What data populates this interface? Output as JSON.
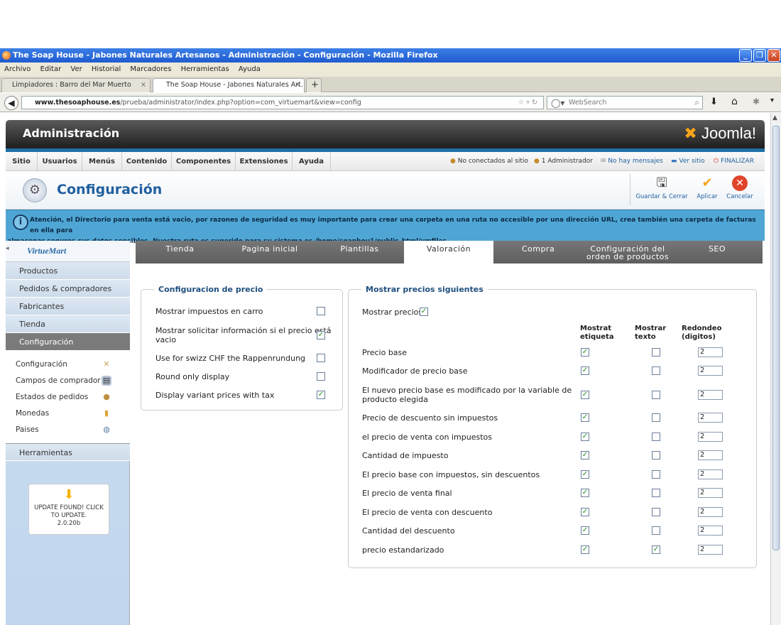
{
  "window": {
    "title": "The Soap House - Jabones Naturales Artesanos - Administración - Configuración - Mozilla Firefox"
  },
  "menubar": [
    "Archivo",
    "Editar",
    "Ver",
    "Historial",
    "Marcadores",
    "Herramientas",
    "Ayuda"
  ],
  "tabs": [
    {
      "label": "Limpiadores : Barro del Mar Muerto"
    },
    {
      "label": "The Soap House - Jabones Naturales Art..."
    }
  ],
  "url": {
    "domain": "www.thesoaphouse.es",
    "path": "/prueba/administrator/index.php?option=com_virtuemart&view=config"
  },
  "search": {
    "placeholder": "WebSearch"
  },
  "admin": {
    "title": "Administración",
    "brand": "Joomla!"
  },
  "topmenu": [
    "Sitio",
    "Usuarios",
    "Menús",
    "Contenido",
    "Componentes",
    "Extensiones",
    "Ayuda"
  ],
  "status": {
    "not_connected": "No conectados al sitio",
    "admins": "1 Administrador",
    "messages": "No hay mensajes",
    "view_site": "Ver sitio",
    "logout": "FINALIZAR"
  },
  "toolbar": {
    "title": "Configuración",
    "save_close": "Guardar & Cerrar",
    "apply": "Aplicar",
    "cancel": "Cancelar"
  },
  "warning": {
    "line1": "Atención, el Directorio para venta está vacio, por razones de seguridad es muy importante para crear una carpeta en una ruta no accesible por una dirección URL, crea también una carpeta de facturas en ella para",
    "line2": "almacenar seguros sus datos sensibles. Nuestra ruta es sugerido para su sistema es /home/soaphou1/public_html/vmfiles"
  },
  "sidebar": {
    "logo": "VirtueMart",
    "items": [
      "Productos",
      "Pedidos & compradores",
      "Fabricantes",
      "Tienda",
      "Configuración"
    ],
    "subitems": [
      "Configuración",
      "Campos de comprador",
      "Estados de pedidos",
      "Monedas",
      "Paises"
    ],
    "tools": "Herramientas",
    "update": "UPDATE FOUND! CLICK TO UPDATE.",
    "version": "2.0.20b"
  },
  "maintabs": [
    "Tienda",
    "Pagina inicial",
    "Plantillas",
    "Valoración",
    "Compra",
    "Configuración del",
    "orden de productos",
    "SEO"
  ],
  "price_config": {
    "legend": "Configuracion de precio",
    "rows": [
      {
        "label": "Mostrar impuestos en carro",
        "checked": false
      },
      {
        "label": "Mostrar solicitar información si el precio está",
        "label2": "vacio",
        "checked": true
      },
      {
        "label": "Use for swizz CHF the Rappenrundung",
        "checked": false
      },
      {
        "label": "Round only display",
        "checked": false
      },
      {
        "label": "Display variant prices with tax",
        "checked": true
      }
    ]
  },
  "show_prices": {
    "legend": "Mostrar precios siguientes",
    "show_label": "Mostrar precios",
    "show_checked": true,
    "col1a": "Mostrat",
    "col1b": "etiqueta",
    "col2a": "Mostrar",
    "col2b": "texto",
    "col3a": "Redondeo",
    "col3b": "(digitos)",
    "rows": [
      {
        "label": "Precio base",
        "label2": "",
        "lbl": true,
        "txt": false,
        "round": "2"
      },
      {
        "label": "Modificador de precio base",
        "label2": "",
        "lbl": true,
        "txt": false,
        "round": "2"
      },
      {
        "label": "El nuevo precio base es modificado por la variable de",
        "label2": "producto elegida",
        "lbl": true,
        "txt": false,
        "round": "2"
      },
      {
        "label": "Precio de descuento sin impuestos",
        "label2": "",
        "lbl": true,
        "txt": false,
        "round": "2"
      },
      {
        "label": "el precio de venta con impuestos",
        "label2": "",
        "lbl": true,
        "txt": false,
        "round": "2"
      },
      {
        "label": "Cantidad de impuesto",
        "label2": "",
        "lbl": true,
        "txt": false,
        "round": "2"
      },
      {
        "label": "El precio base con impuestos, sin descuentos",
        "label2": "",
        "lbl": true,
        "txt": false,
        "round": "2"
      },
      {
        "label": "El precio de venta final",
        "label2": "",
        "lbl": true,
        "txt": false,
        "round": "2"
      },
      {
        "label": "El precio de venta con descuento",
        "label2": "",
        "lbl": true,
        "txt": false,
        "round": "2"
      },
      {
        "label": "Cantidad del descuento",
        "label2": "",
        "lbl": true,
        "txt": false,
        "round": "2"
      },
      {
        "label": "precio estandarizado",
        "label2": "",
        "lbl": true,
        "txt": true,
        "round": "2"
      }
    ]
  }
}
